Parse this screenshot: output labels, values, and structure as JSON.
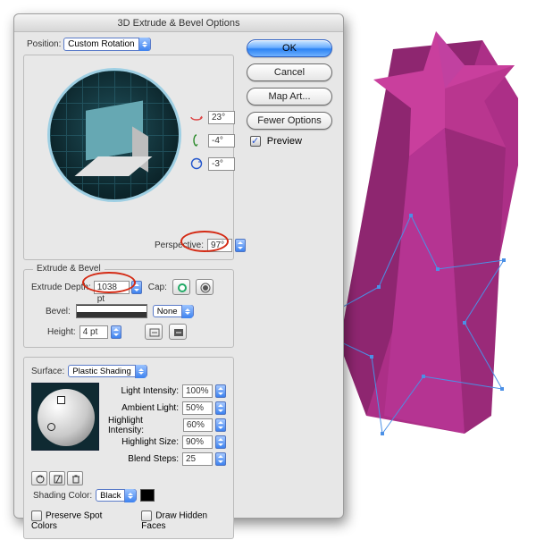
{
  "dialog": {
    "title": "3D Extrude & Bevel Options",
    "buttons": {
      "ok": "OK",
      "cancel": "Cancel",
      "mapart": "Map Art...",
      "feweroptions": "Fewer Options"
    },
    "preview_label": "Preview",
    "position": {
      "label": "Position:",
      "selected": "Custom Rotation",
      "rot_x": "23°",
      "rot_y": "-4°",
      "rot_z": "-3°",
      "perspective_label": "Perspective:",
      "perspective": "97°"
    },
    "extrude": {
      "group_label": "Extrude & Bevel",
      "depth_label": "Extrude Depth:",
      "depth": "1038 pt",
      "cap_label": "Cap:",
      "bevel_label": "Bevel:",
      "bevel": "None",
      "height_label": "Height:",
      "height": "4 pt"
    },
    "surface": {
      "label": "Surface:",
      "selected": "Plastic Shading",
      "light_intensity_label": "Light Intensity:",
      "light_intensity": "100%",
      "ambient_label": "Ambient Light:",
      "ambient": "50%",
      "hi_intensity_label": "Highlight Intensity:",
      "hi_intensity": "60%",
      "hi_size_label": "Highlight Size:",
      "hi_size": "90%",
      "blend_label": "Blend Steps:",
      "blend": "25",
      "shade_color_label": "Shading Color:",
      "shade_color": "Black",
      "preserve_spot": "Preserve Spot Colors",
      "hidden_faces": "Draw Hidden Faces"
    }
  },
  "colors": {
    "star_light": "#c93f9d",
    "star_mid": "#b03189",
    "star_dark": "#8a2069",
    "outline": "#3f8de8",
    "highlight": "#d42a14"
  }
}
